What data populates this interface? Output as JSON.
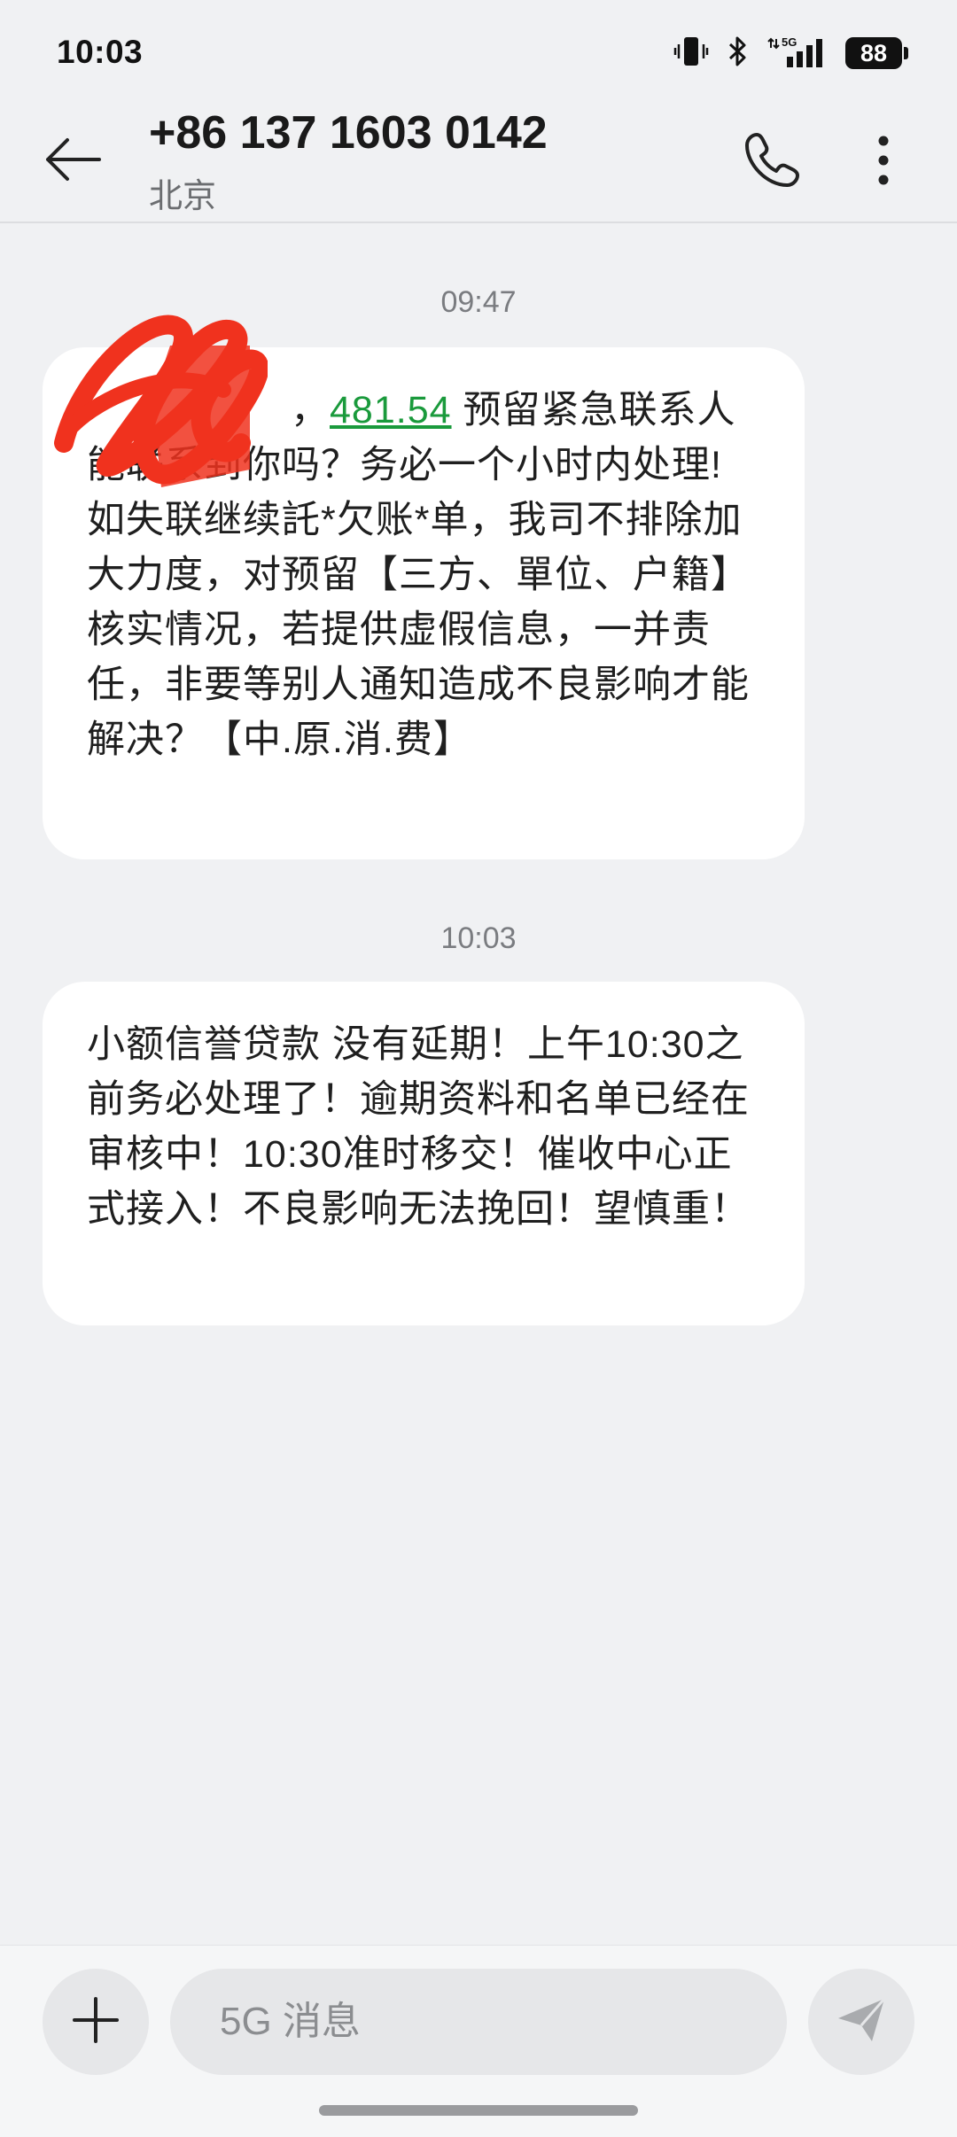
{
  "status_bar": {
    "time": "10:03",
    "network": "5G",
    "battery": "88"
  },
  "header": {
    "contact_number": "+86 137 1603 0142",
    "location": "北京"
  },
  "messages": [
    {
      "time": "09:47",
      "text_before_amount": "，",
      "amount": "481.54",
      "text_after_amount": " 预留紧急联系人能联系到你吗？务必一个小时内处理!如失联继续託*欠账*单，我司不排除加大力度，对预留【三方、單位、户籍】核实情况，若提供虚假信息，一并责任，非要等别人通知造成不良影响才能解决？【中.原.消.费】"
    },
    {
      "time": "10:03",
      "text": "小额信誉贷款 没有延期！上午10:30之前务必处理了！逾期资料和名单已经在审核中！10:30准时移交！催收中心正式接入！不良影响无法挽回！望慎重！"
    }
  ],
  "composer": {
    "placeholder": "5G 消息"
  },
  "colors": {
    "background": "#f0f1f3",
    "bubble": "#ffffff",
    "link_green": "#1a9a3c",
    "redaction_red": "#f0321e"
  },
  "icons": [
    "back-arrow-icon",
    "phone-icon",
    "more-vert-icon",
    "plus-icon",
    "send-icon",
    "vibrate-icon",
    "bluetooth-icon",
    "signal-icon"
  ]
}
